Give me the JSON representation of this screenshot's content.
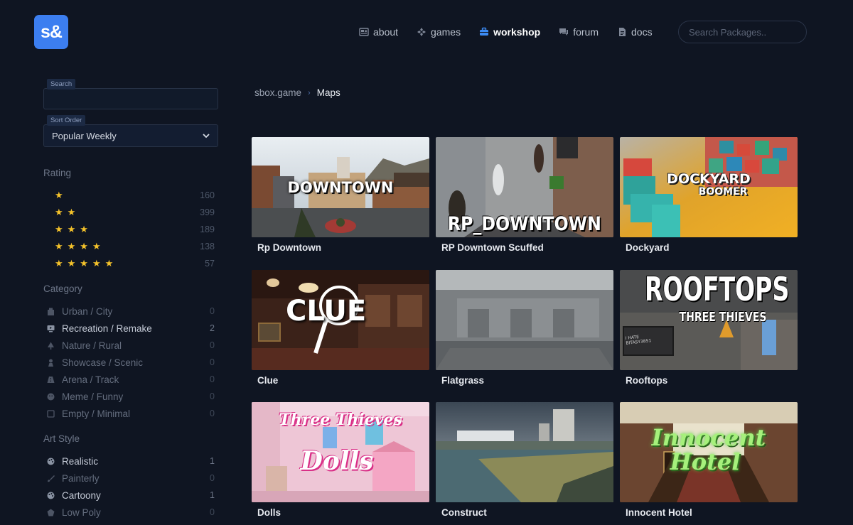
{
  "brand": {
    "logo_text": "s&"
  },
  "nav": {
    "items": [
      {
        "label": "about",
        "icon": "newspaper-icon",
        "active": false
      },
      {
        "label": "games",
        "icon": "gamepad-icon",
        "active": false
      },
      {
        "label": "workshop",
        "icon": "briefcase-icon",
        "active": true
      },
      {
        "label": "forum",
        "icon": "chat-icon",
        "active": false
      },
      {
        "label": "docs",
        "icon": "document-icon",
        "active": false
      }
    ],
    "search_placeholder": "Search Packages.."
  },
  "sidebar": {
    "search_label": "Search",
    "search_value": "",
    "sort_label": "Sort Order",
    "sort_value": "Popular Weekly",
    "rating": {
      "title": "Rating",
      "items": [
        {
          "stars": "★",
          "count": "160"
        },
        {
          "stars": "★★",
          "count": "399"
        },
        {
          "stars": "★★★",
          "count": "189"
        },
        {
          "stars": "★★★★",
          "count": "138"
        },
        {
          "stars": "★★★★★",
          "count": "57"
        }
      ]
    },
    "category": {
      "title": "Category",
      "items": [
        {
          "label": "Urban / City",
          "count": "0",
          "icon": "building-icon"
        },
        {
          "label": "Recreation / Remake",
          "count": "2",
          "icon": "monitor-icon"
        },
        {
          "label": "Nature / Rural",
          "count": "0",
          "icon": "tree-icon"
        },
        {
          "label": "Showcase / Scenic",
          "count": "0",
          "icon": "pedestal-icon"
        },
        {
          "label": "Arena / Track",
          "count": "0",
          "icon": "road-icon"
        },
        {
          "label": "Meme / Funny",
          "count": "0",
          "icon": "smiley-icon"
        },
        {
          "label": "Empty / Minimal",
          "count": "0",
          "icon": "square-icon"
        }
      ]
    },
    "art_style": {
      "title": "Art Style",
      "items": [
        {
          "label": "Realistic",
          "count": "1",
          "icon": "palette-icon"
        },
        {
          "label": "Painterly",
          "count": "0",
          "icon": "brush-icon"
        },
        {
          "label": "Cartoony",
          "count": "1",
          "icon": "palette-icon"
        },
        {
          "label": "Low Poly",
          "count": "0",
          "icon": "pentagon-icon"
        }
      ]
    }
  },
  "breadcrumb": {
    "root": "sbox.game",
    "separator": "›",
    "current": "Maps"
  },
  "maps": [
    {
      "title": "Rp Downtown",
      "thumb_text": "DOWNTOWN"
    },
    {
      "title": "RP Downtown Scuffed",
      "thumb_text": "RP_DOWNTOWN"
    },
    {
      "title": "Dockyard",
      "thumb_text": "DOCKYARD",
      "thumb_text2": "BOOMER"
    },
    {
      "title": "Clue",
      "thumb_text": "CLUE"
    },
    {
      "title": "Flatgrass",
      "thumb_text": ""
    },
    {
      "title": "Rooftops",
      "thumb_text": "ROOFTOPS",
      "thumb_text2": "THREE THIEVES",
      "thumb_sign": "I HATE BITASY3851"
    },
    {
      "title": "Dolls",
      "thumb_text": "Three Thieves",
      "thumb_text2": "Dolls"
    },
    {
      "title": "Construct",
      "thumb_text": ""
    },
    {
      "title": "Innocent Hotel",
      "thumb_text": "Innocent",
      "thumb_text2": "Hotel"
    }
  ]
}
